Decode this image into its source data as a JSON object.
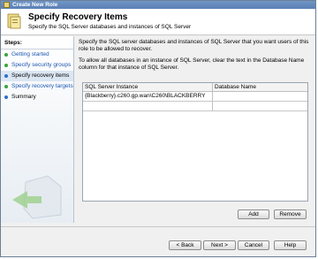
{
  "window": {
    "title": "Create New Role"
  },
  "header": {
    "title": "Specify Recovery Items",
    "subtitle": "Specify the SQL Server databases and instances of SQL Server"
  },
  "steps": {
    "label": "Steps:",
    "items": [
      {
        "label": "Getting started",
        "state": "done"
      },
      {
        "label": "Specify security groups",
        "state": "done"
      },
      {
        "label": "Specify recovery items",
        "state": "current"
      },
      {
        "label": "Specify recovery targets",
        "state": "done"
      },
      {
        "label": "Summary",
        "state": "pending"
      }
    ]
  },
  "main": {
    "intro": "Specify the SQL server databases and instances of SQL Server that you want users of this role to be allowed to recover.",
    "instructions": "To allow all databases in an instance of SQL Server, clear the text in the Database Name column for that instance of SQL Server.",
    "table": {
      "columns": [
        "SQL Server Instance",
        "Database Name"
      ],
      "rows": [
        [
          "{Blackberry}.c260.gp.wan\\C260\\BLACKBERRY",
          ""
        ],
        [
          "",
          ""
        ]
      ]
    },
    "add_label": "Add",
    "remove_label": "Remove"
  },
  "footer": {
    "back_label": "< Back",
    "next_label": "Next >",
    "cancel_label": "Cancel",
    "help_label": "Help"
  }
}
